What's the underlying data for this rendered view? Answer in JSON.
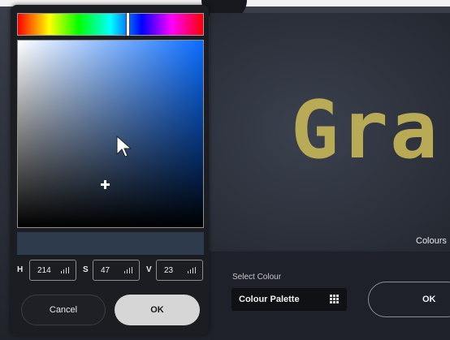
{
  "preview": {
    "text": "Gra",
    "text_color": "#b9ab55",
    "colours_label": "Colours"
  },
  "select_colour": {
    "label": "Select Colour",
    "palette_button": "Colour Palette",
    "palette_icon": "grid-icon"
  },
  "dialog_ok_label": "OK",
  "picker": {
    "hue_color": "#0a6cff",
    "selected_color": "#2d3b4d",
    "hue_position": 0.594,
    "saturation": 0.47,
    "value": 0.23,
    "fields": [
      {
        "letter": "H",
        "value": "214"
      },
      {
        "letter": "S",
        "value": "47"
      },
      {
        "letter": "V",
        "value": "23"
      }
    ],
    "cancel_label": "Cancel",
    "ok_label": "OK"
  }
}
